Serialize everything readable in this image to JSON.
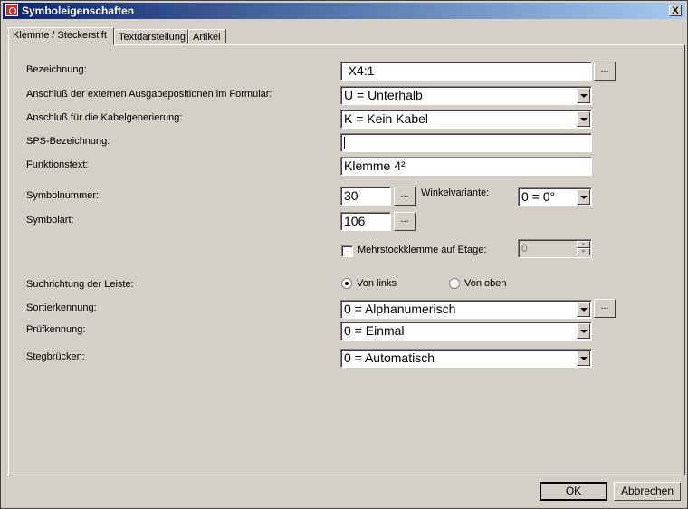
{
  "window": {
    "title": "Symboleigenschaften",
    "close": "X"
  },
  "tabs": [
    {
      "label": "Klemme / Steckerstift",
      "active": true
    },
    {
      "label": "Textdarstellung",
      "active": false
    },
    {
      "label": "Artikel",
      "active": false
    }
  ],
  "form": {
    "bezeichnung": {
      "label": "Bezeichnung:",
      "value": "-X4:1",
      "browse": "..."
    },
    "anschluss_ausgabe": {
      "label": "Anschluß der externen Ausgabepositionen im Formular:",
      "value": "U = Unterhalb"
    },
    "anschluss_kabel": {
      "label": "Anschluß für die Kabelgenerierung:",
      "value": "K = Kein Kabel"
    },
    "sps": {
      "label": "SPS-Bezeichnung:",
      "value": ""
    },
    "funktionstext": {
      "label": "Funktionstext:",
      "value": "Klemme 4²"
    },
    "symbolnummer": {
      "label": "Symbolnummer:",
      "value": "30",
      "browse": "..."
    },
    "winkelvariante": {
      "label": "Winkelvariante:",
      "value": "0 = 0°"
    },
    "symbolart": {
      "label": "Symbolart:",
      "value": "106",
      "browse": "..."
    },
    "mehrstock": {
      "label": "Mehrstockklemme auf Etage:",
      "checked": false,
      "value": "0"
    },
    "suchrichtung": {
      "label": "Suchrichtung der Leiste:",
      "option1": "Von links",
      "option2": "Von oben",
      "selected": "Von links"
    },
    "sortierkennung": {
      "label": "Sortierkennung:",
      "value": "0 = Alphanumerisch",
      "browse": "..."
    },
    "pruefkennung": {
      "label": "Prüfkennung:",
      "value": "0 = Einmal"
    },
    "stegbruecken": {
      "label": "Stegbrücken:",
      "value": "0 = Automatisch"
    }
  },
  "buttons": {
    "ok": "OK",
    "cancel": "Abbrechen"
  }
}
